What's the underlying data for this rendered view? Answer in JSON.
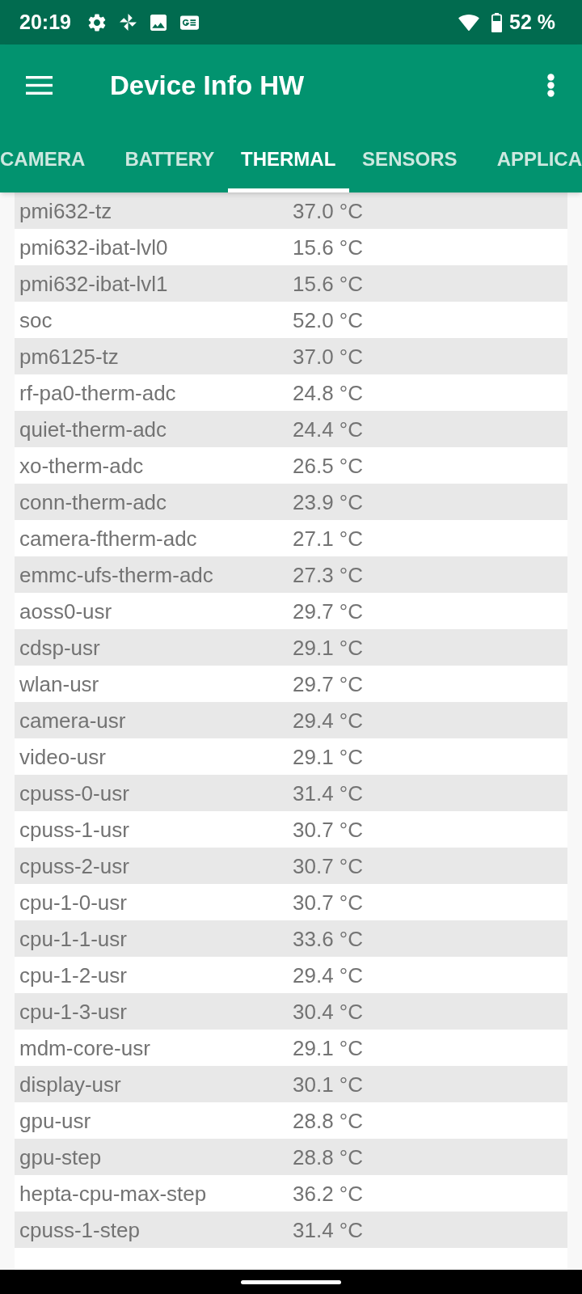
{
  "status_bar": {
    "time": "20:19",
    "battery": "52 %"
  },
  "app_bar": {
    "title": "Device Info HW"
  },
  "tabs": [
    {
      "label": "CAMERA",
      "selected": false
    },
    {
      "label": "BATTERY",
      "selected": false
    },
    {
      "label": "THERMAL",
      "selected": true
    },
    {
      "label": "SENSORS",
      "selected": false
    },
    {
      "label": "APPLICA",
      "selected": false
    }
  ],
  "rows": [
    {
      "name": "pmi632-tz",
      "value": "37.0 °C"
    },
    {
      "name": "pmi632-ibat-lvl0",
      "value": "15.6 °C"
    },
    {
      "name": "pmi632-ibat-lvl1",
      "value": "15.6 °C"
    },
    {
      "name": "soc",
      "value": "52.0 °C"
    },
    {
      "name": "pm6125-tz",
      "value": "37.0 °C"
    },
    {
      "name": "rf-pa0-therm-adc",
      "value": "24.8 °C"
    },
    {
      "name": "quiet-therm-adc",
      "value": "24.4 °C"
    },
    {
      "name": "xo-therm-adc",
      "value": "26.5 °C"
    },
    {
      "name": "conn-therm-adc",
      "value": "23.9 °C"
    },
    {
      "name": "camera-ftherm-adc",
      "value": "27.1 °C"
    },
    {
      "name": "emmc-ufs-therm-adc",
      "value": "27.3 °C"
    },
    {
      "name": "aoss0-usr",
      "value": "29.7 °C"
    },
    {
      "name": "cdsp-usr",
      "value": "29.1 °C"
    },
    {
      "name": "wlan-usr",
      "value": "29.7 °C"
    },
    {
      "name": "camera-usr",
      "value": "29.4 °C"
    },
    {
      "name": "video-usr",
      "value": "29.1 °C"
    },
    {
      "name": "cpuss-0-usr",
      "value": "31.4 °C"
    },
    {
      "name": "cpuss-1-usr",
      "value": "30.7 °C"
    },
    {
      "name": "cpuss-2-usr",
      "value": "30.7 °C"
    },
    {
      "name": "cpu-1-0-usr",
      "value": "30.7 °C"
    },
    {
      "name": "cpu-1-1-usr",
      "value": "33.6 °C"
    },
    {
      "name": "cpu-1-2-usr",
      "value": "29.4 °C"
    },
    {
      "name": "cpu-1-3-usr",
      "value": "30.4 °C"
    },
    {
      "name": "mdm-core-usr",
      "value": "29.1 °C"
    },
    {
      "name": "display-usr",
      "value": "30.1 °C"
    },
    {
      "name": "gpu-usr",
      "value": "28.8 °C"
    },
    {
      "name": "gpu-step",
      "value": "28.8 °C"
    },
    {
      "name": "hepta-cpu-max-step",
      "value": "36.2 °C"
    },
    {
      "name": "cpuss-1-step",
      "value": "31.4 °C"
    }
  ]
}
